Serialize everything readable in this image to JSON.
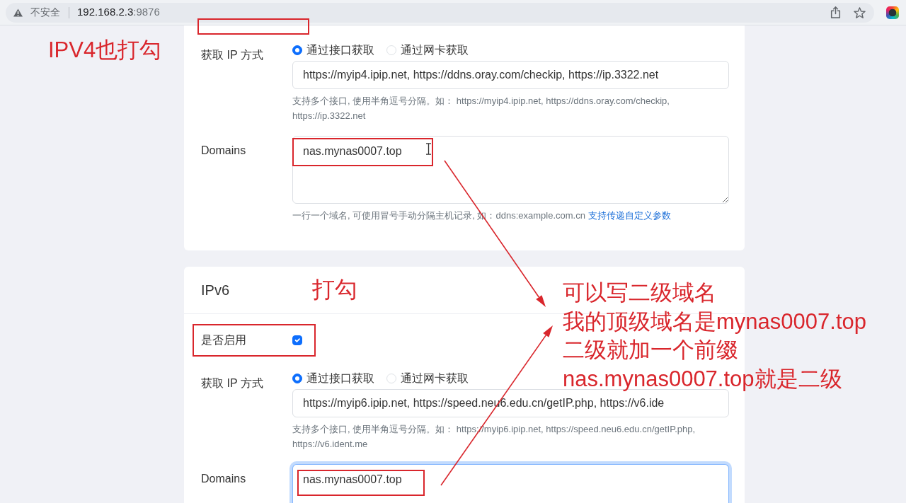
{
  "browser": {
    "security_label": "不安全",
    "address_host": "192.168.2.3",
    "address_port": ":9876"
  },
  "sections": [
    {
      "rows": [
        {
          "kind": "method",
          "label": "获取 IP 方式",
          "options": [
            {
              "label": "通过接口获取",
              "selected": true
            },
            {
              "label": "通过网卡获取",
              "selected": false
            }
          ],
          "value": "https://myip4.ipip.net, https://ddns.oray.com/checkip, https://ip.3322.net",
          "help": "支持多个接口, 使用半角逗号分隔。如： https://myip4.ipip.net, https://ddns.oray.com/checkip, https://ip.3322.net"
        },
        {
          "kind": "textarea",
          "label": "Domains",
          "value": "nas.mynas0007.top",
          "focused": false,
          "help": "一行一个域名, 可使用冒号手动分隔主机记录, 如：ddns:example.com.cn",
          "help_link": "支持传递自定义参数"
        }
      ]
    },
    {
      "title": "IPv6",
      "note": "打勾",
      "rows": [
        {
          "kind": "checkbox",
          "label": "是否启用",
          "checked": true
        },
        {
          "kind": "method",
          "label": "获取 IP 方式",
          "options": [
            {
              "label": "通过接口获取",
              "selected": true
            },
            {
              "label": "通过网卡获取",
              "selected": false
            }
          ],
          "value": "https://myip6.ipip.net, https://speed.neu6.edu.cn/getIP.php, https://v6.ide",
          "help": "支持多个接口, 使用半角逗号分隔。如： https://myip6.ipip.net, https://speed.neu6.edu.cn/getIP.php, https://v6.ident.me"
        },
        {
          "kind": "textarea",
          "label": "Domains",
          "value": "nas.mynas0007.top",
          "focused": true
        }
      ]
    }
  ],
  "annotations": [
    {
      "lines": [
        "IPV4也打勾"
      ]
    },
    {
      "lines": [
        "可以写二级域名",
        "我的顶级域名是mynas0007.top",
        "二级就加一个前缀",
        "nas.mynas0007.top就是二级"
      ]
    }
  ]
}
